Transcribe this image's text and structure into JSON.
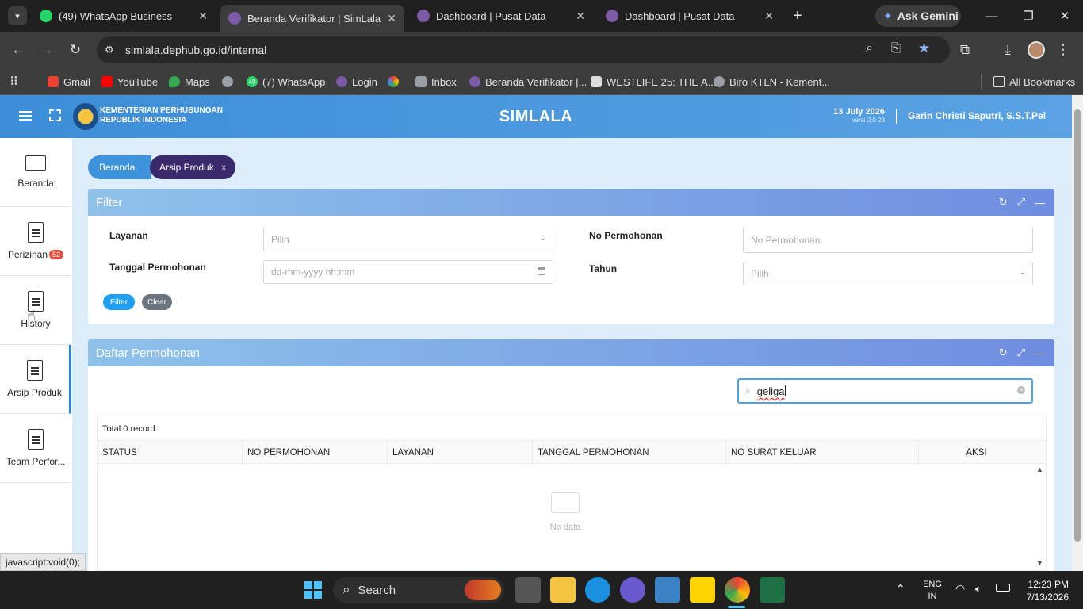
{
  "browser": {
    "tabs": [
      {
        "title": "(49) WhatsApp Business",
        "active": false
      },
      {
        "title": "Beranda Verifikator | SimLala",
        "active": true
      },
      {
        "title": "Dashboard | Pusat Data",
        "active": false
      },
      {
        "title": "Dashboard | Pusat Data",
        "active": false
      }
    ],
    "ask_gemini": "Ask Gemini",
    "url": "simlala.dephub.go.id/internal",
    "bookmarks": [
      "Gmail",
      "YouTube",
      "Maps",
      "(7) WhatsApp",
      "Login",
      "Inbox",
      "Beranda Verifikator |...",
      "WESTLIFE 25: THE A...",
      "Biro KTLN - Kement..."
    ],
    "whatsapp_badge": "49",
    "all_bookmarks": "All Bookmarks"
  },
  "app": {
    "org_line1": "KEMENTERIAN PERHUBUNGAN",
    "org_line2": "REPUBLIK INDONESIA",
    "title": "SIMLALA",
    "date": "13 July 2026",
    "version": "versi 2.0.28",
    "user": "Garin Christi Saputri, S.S.T.Pel"
  },
  "sidebar": [
    {
      "label": "Beranda",
      "badge": ""
    },
    {
      "label": "Perizinan",
      "badge": "52"
    },
    {
      "label": "History",
      "badge": ""
    },
    {
      "label": "Arsip Produk",
      "badge": ""
    },
    {
      "label": "Team Perfor...",
      "badge": ""
    }
  ],
  "breadcrumb": {
    "home": "Beranda",
    "current": "Arsip Produk",
    "close": "x"
  },
  "filter": {
    "title": "Filter",
    "layanan_label": "Layanan",
    "layanan_placeholder": "Pilih",
    "tanggal_label": "Tanggal Permohonan",
    "tanggal_placeholder": "dd-mm-yyyy hh:mm",
    "nopermohonan_label": "No Permohonan",
    "nopermohonan_placeholder": "No Permohonan",
    "tahun_label": "Tahun",
    "tahun_placeholder": "Pilih",
    "filter_btn": "Filter",
    "clear_btn": "Clear"
  },
  "daftar": {
    "title": "Daftar Permohonan",
    "search_value": "geliga",
    "total": "Total 0 record",
    "columns": [
      "STATUS",
      "NO PERMOHONAN",
      "LAYANAN",
      "TANGGAL PERMOHONAN",
      "NO SURAT KELUAR",
      "AKSI"
    ],
    "empty": "No data"
  },
  "status_bar": "javascript:void(0);",
  "taskbar": {
    "search": "Search",
    "lang1": "ENG",
    "lang2": "IN",
    "time": "12:23 PM",
    "date": "7/13/2026"
  },
  "colors": {
    "accent": "#1e88e5",
    "breadcrumb_active": "#3a2a6b",
    "header": "#3c8ed8"
  }
}
